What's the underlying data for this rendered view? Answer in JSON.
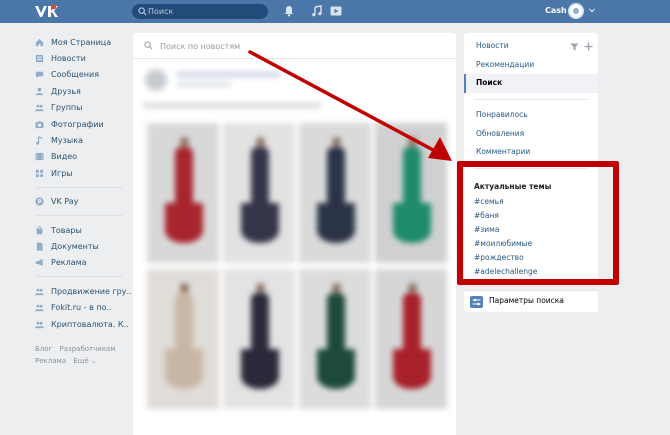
{
  "header": {
    "search": {
      "placeholder": "Поиск",
      "value": ""
    },
    "username": "Cash",
    "icons": [
      "vk-logo-icon",
      "bell-icon",
      "music-icon",
      "video-icon",
      "chevron-down-icon"
    ],
    "bg_color": "#4a76a8"
  },
  "sidebar": {
    "group1": [
      {
        "label": "Моя Страница",
        "icon": "home-icon"
      },
      {
        "label": "Новости",
        "icon": "news-icon"
      },
      {
        "label": "Сообщения",
        "icon": "messages-icon"
      },
      {
        "label": "Друзья",
        "icon": "friends-icon"
      },
      {
        "label": "Группы",
        "icon": "groups-icon"
      },
      {
        "label": "Фотографии",
        "icon": "camera-icon"
      },
      {
        "label": "Музыка",
        "icon": "music-icon"
      },
      {
        "label": "Видео",
        "icon": "video-icon"
      },
      {
        "label": "Игры",
        "icon": "games-icon"
      }
    ],
    "group2": [
      {
        "label": "VK Pay",
        "icon": "vkpay-icon"
      }
    ],
    "group3": [
      {
        "label": "Товары",
        "icon": "goods-icon"
      },
      {
        "label": "Документы",
        "icon": "documents-icon"
      },
      {
        "label": "Реклама",
        "icon": "ads-icon"
      }
    ],
    "group4": [
      {
        "label": "Продвижение гру..",
        "icon": "community-icon"
      },
      {
        "label": "Fokit.ru - в по..",
        "icon": "community-icon"
      },
      {
        "label": "Криптовалюта. К..",
        "icon": "community-icon"
      }
    ],
    "footer": {
      "blog": "Блог",
      "developers": "Разработчикам",
      "ads": "Реклама",
      "more": "Ещё ⌄"
    }
  },
  "main": {
    "news_search": {
      "placeholder": "Поиск по новостям",
      "value": ""
    },
    "dress_colors": [
      "#a8252e",
      "#35354a",
      "#2b3447",
      "#1f8a6c",
      "#9a3a3a",
      "#2a2a3a",
      "#1e4a3a",
      "#a8202a"
    ]
  },
  "right_nav": {
    "items_top": [
      "Новости",
      "Рекомендации"
    ],
    "active": "Поиск",
    "items_bottom": [
      "Понравилось",
      "Обновления",
      "Комментарии"
    ],
    "icons": [
      "filter-icon",
      "plus-icon"
    ]
  },
  "topics": {
    "title": "Актуальные темы",
    "items": [
      "#семья",
      "#баня",
      "#зима",
      "#моилюбимые",
      "#рождество",
      "#adelechallenge"
    ]
  },
  "search_params": {
    "label": "Параметры поиска",
    "icon": "sliders-icon"
  },
  "annotation": {
    "color": "#c00000"
  }
}
